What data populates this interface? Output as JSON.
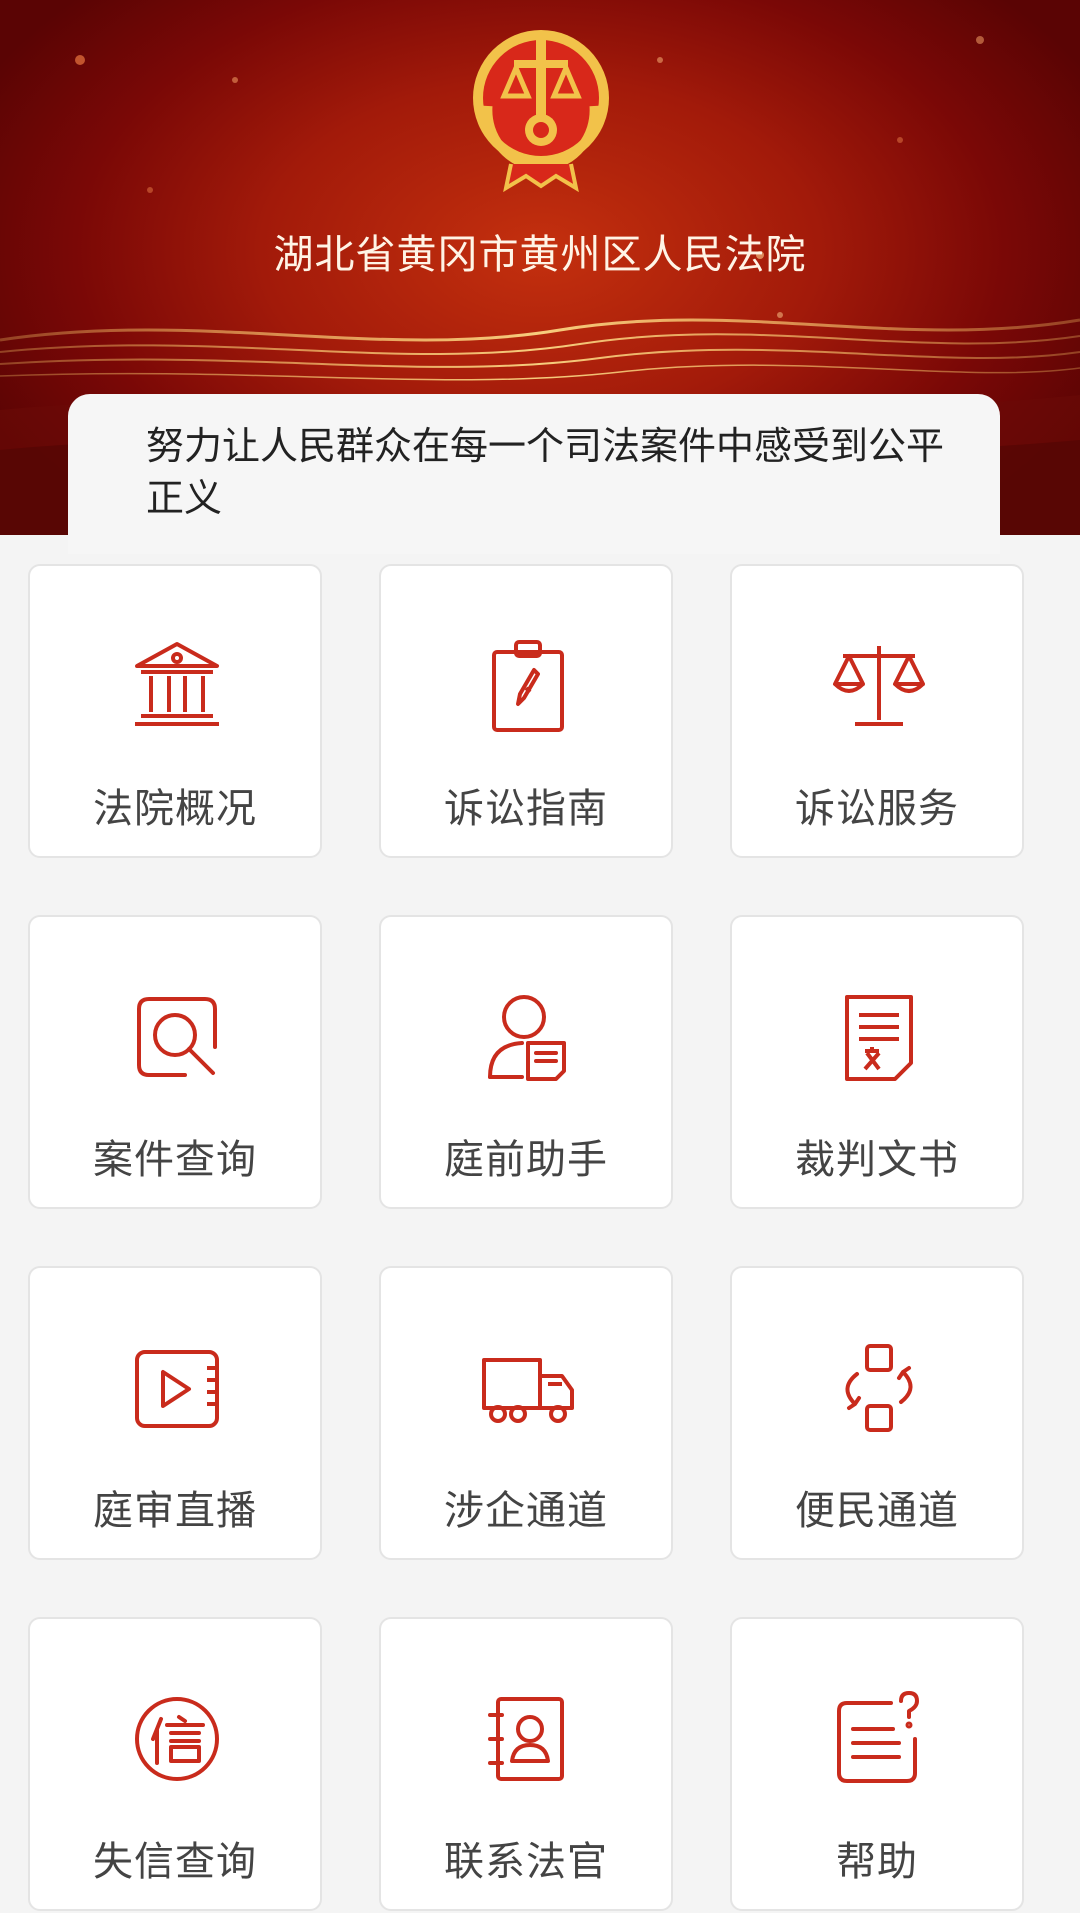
{
  "header": {
    "court_name": "湖北省黄冈市黄州区人民法院",
    "slogan": "努力让人民群众在每一个司法案件中感受到公平正义"
  },
  "theme": {
    "accent": "#c92b1c",
    "header_red": "#a21a0a",
    "gold": "#f2c24a"
  },
  "menu": {
    "items": [
      {
        "label": "法院概况",
        "icon": "courthouse-icon"
      },
      {
        "label": "诉讼指南",
        "icon": "compass-clipboard-icon"
      },
      {
        "label": "诉讼服务",
        "icon": "scales-icon"
      },
      {
        "label": "案件查询",
        "icon": "search-icon"
      },
      {
        "label": "庭前助手",
        "icon": "user-document-icon"
      },
      {
        "label": "裁判文书",
        "icon": "document-icon"
      },
      {
        "label": "庭审直播",
        "icon": "video-play-icon"
      },
      {
        "label": "涉企通道",
        "icon": "truck-icon"
      },
      {
        "label": "便民通道",
        "icon": "swap-icon"
      },
      {
        "label": "失信查询",
        "icon": "credit-icon"
      },
      {
        "label": "联系法官",
        "icon": "contact-card-icon"
      },
      {
        "label": "帮助",
        "icon": "help-icon"
      }
    ]
  }
}
